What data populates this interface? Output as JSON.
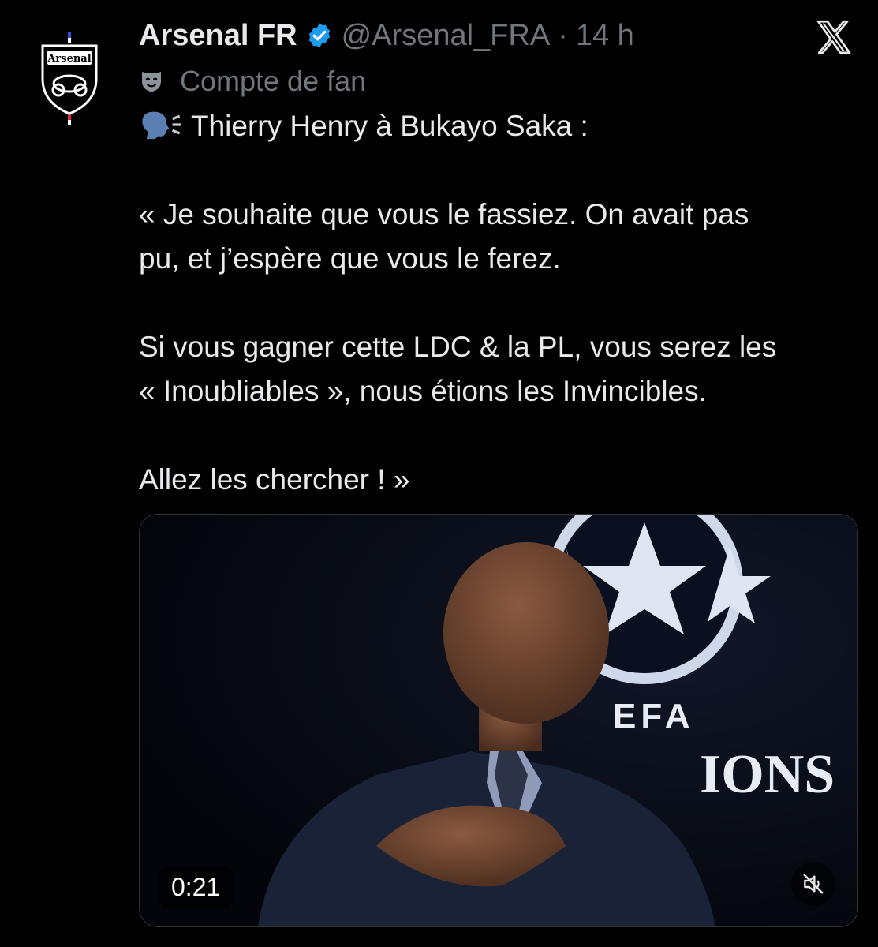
{
  "author": {
    "display_name": "Arsenal FR",
    "handle": "@Arsenal_FRA",
    "separator": "·",
    "time": "14 h",
    "avatar_text": "Arsenal",
    "fan_label": "Compte de fan"
  },
  "tweet": {
    "lines": [
      "Thierry Henry à Bukayo Saka :",
      "",
      "« Je souhaite que vous le fassiez. On avait pas",
      "pu, et j’espère que vous le ferez.",
      "",
      "Si vous gagner cette LDC & la PL, vous serez les",
      "« Inoubliables », nous étions les Invincibles.",
      "",
      "Allez les chercher ! »"
    ]
  },
  "media": {
    "duration": "0:21",
    "background_text_1": "EFA",
    "background_text_2": "IONS"
  },
  "icons": {
    "verified": "verified-badge-icon",
    "x": "x-logo-icon",
    "fan": "theater-mask-icon",
    "speaker": "speaking-head-icon",
    "mute": "speaker-muted-icon"
  },
  "colors": {
    "background": "#000000",
    "text": "#e7e9ea",
    "secondary": "#71767b",
    "verified": "#1d9bf0"
  }
}
